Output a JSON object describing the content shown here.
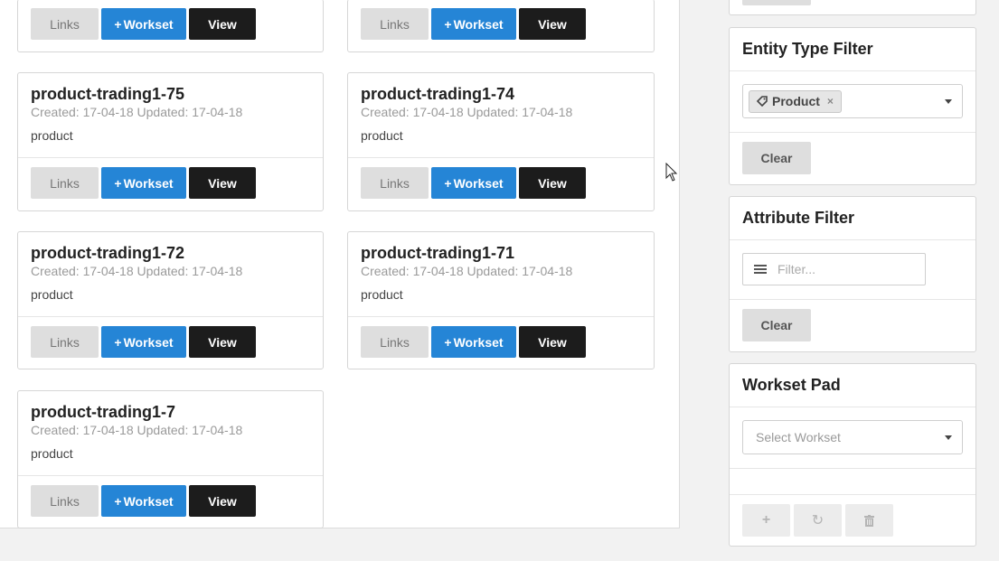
{
  "buttons": {
    "links": "Links",
    "workset_plus": "+",
    "workset": "Workset",
    "view": "View"
  },
  "cards": [
    {
      "title": "product-trading1-75",
      "meta": "Created: 17-04-18 Updated: 17-04-18",
      "type": "product"
    },
    {
      "title": "product-trading1-74",
      "meta": "Created: 17-04-18 Updated: 17-04-18",
      "type": "product"
    },
    {
      "title": "product-trading1-72",
      "meta": "Created: 17-04-18 Updated: 17-04-18",
      "type": "product"
    },
    {
      "title": "product-trading1-71",
      "meta": "Created: 17-04-18 Updated: 17-04-18",
      "type": "product"
    },
    {
      "title": "product-trading1-7",
      "meta": "Created: 17-04-18 Updated: 17-04-18",
      "type": "product"
    }
  ],
  "entity_filter": {
    "title": "Entity Type Filter",
    "tag_label": "Product",
    "tag_remove": "×",
    "clear_label": "Clear"
  },
  "attribute_filter": {
    "title": "Attribute Filter",
    "placeholder": "Filter...",
    "clear_label": "Clear"
  },
  "workset_pad": {
    "title": "Workset Pad",
    "select_placeholder": "Select Workset",
    "add_icon": "+",
    "refresh_icon": "↻",
    "delete_icon": "🗑"
  },
  "icons": {
    "tag": "tag-icon",
    "plus": "plus-icon",
    "list": "list-icon",
    "caret": "caret-down-icon",
    "cursor": "mouse-pointer-icon"
  },
  "colors": {
    "workset_blue": "#2585d6",
    "view_black": "#1c1c1c",
    "links_grey": "#dedede"
  }
}
